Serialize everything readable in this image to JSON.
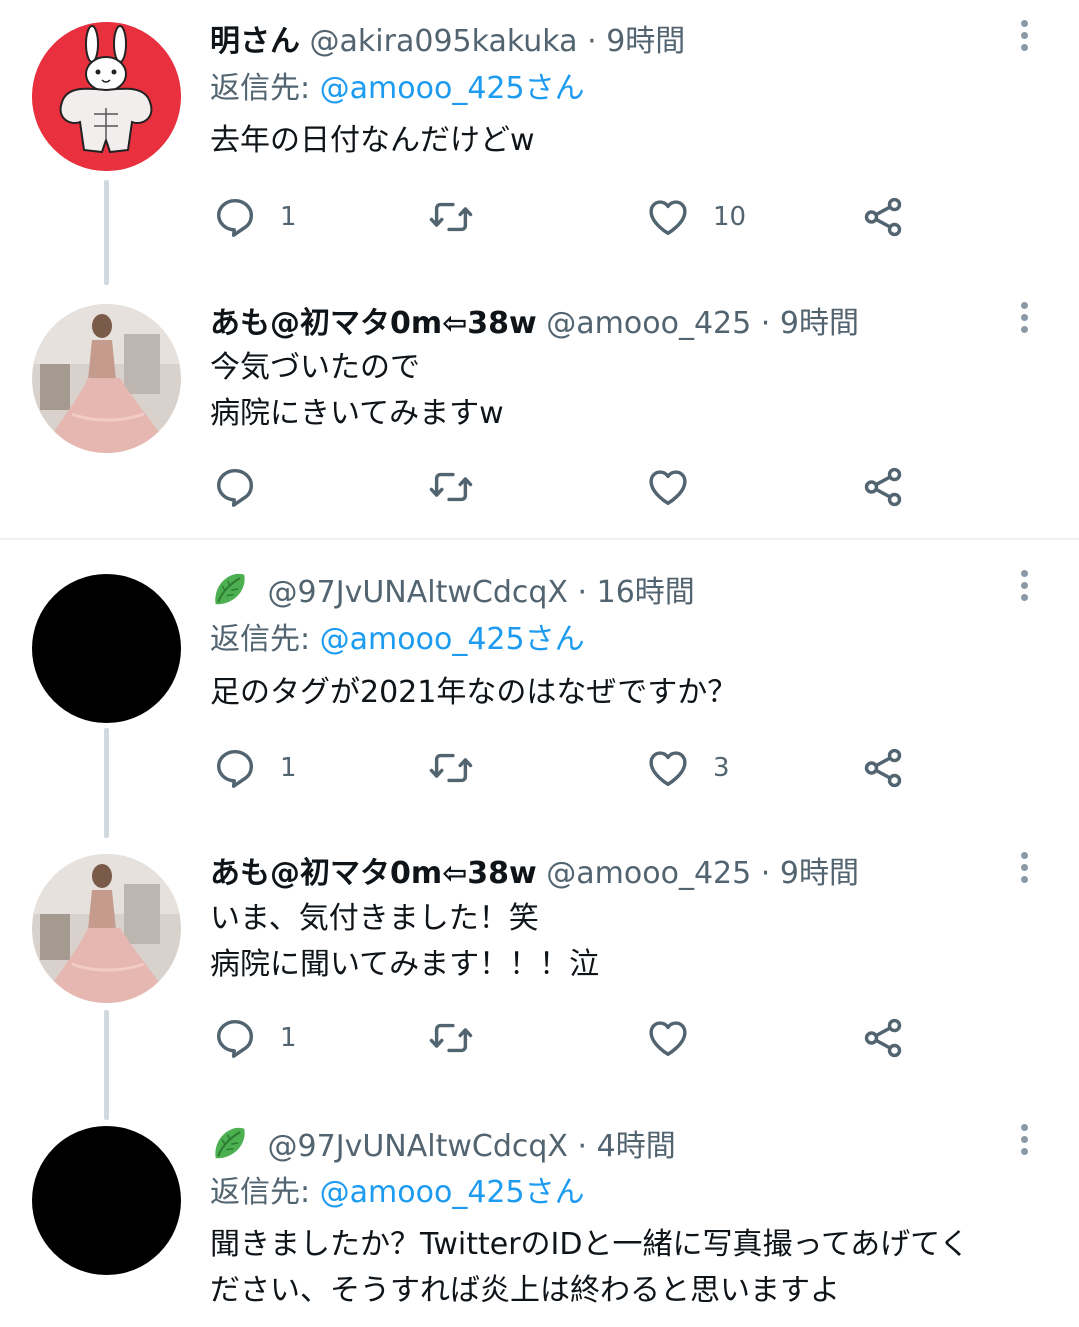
{
  "tweets": [
    {
      "name": "明さん",
      "handle": "@akira095kakuka",
      "dot": "·",
      "time": "9時間",
      "reply_prefix": "返信先: ",
      "reply_mention": "@amooo_425さん",
      "text": "去年の日付なんだけどw",
      "reply_count": "1",
      "like_count": "10"
    },
    {
      "name": "あも@初マタ0m⇦38w",
      "handle": "@amooo_425",
      "dot": "·",
      "time": "9時間",
      "text": "今気づいたので\n病院にきいてみますw",
      "reply_count": "",
      "like_count": ""
    },
    {
      "name": "",
      "handle": "@97JvUNAltwCdcqX",
      "dot": "·",
      "time": "16時間",
      "reply_prefix": "返信先: ",
      "reply_mention": "@amooo_425さん",
      "text": "足のタグが2021年なのはなぜですか？",
      "reply_count": "1",
      "like_count": "3"
    },
    {
      "name": "あも@初マタ0m⇦38w",
      "handle": "@amooo_425",
      "dot": "·",
      "time": "9時間",
      "text": "いま、気付きました！笑\n病院に聞いてみます！！！泣",
      "reply_count": "1",
      "like_count": ""
    },
    {
      "name": "",
      "handle": "@97JvUNAltwCdcqX",
      "dot": "·",
      "time": "4時間",
      "reply_prefix": "返信先: ",
      "reply_mention": "@amooo_425さん",
      "text": "聞きましたか？TwitterのIDと一緒に写真撮ってあげてく\nださい、そうすれば炎上は終わると思いますよ"
    }
  ],
  "colors": {
    "accent": "#1d9bf0",
    "secondary_text": "#536471",
    "thread_line": "#cfd9de"
  },
  "icons": [
    "reply-icon",
    "retweet-icon",
    "like-icon",
    "share-icon",
    "more-icon",
    "leafy-green-emoji"
  ]
}
